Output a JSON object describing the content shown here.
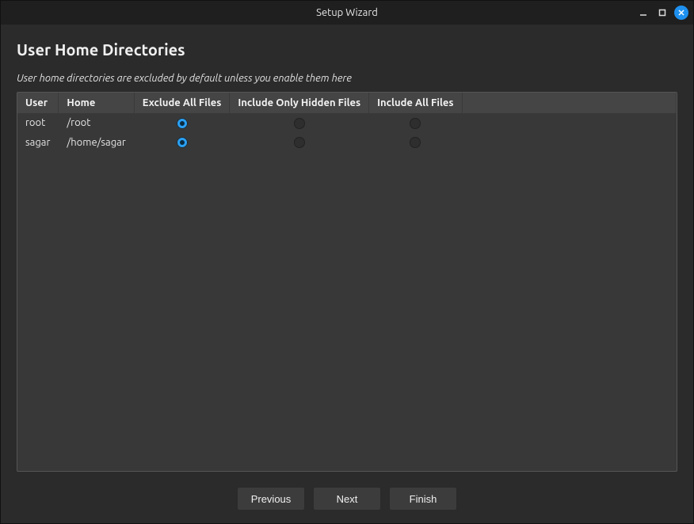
{
  "window": {
    "title": "Setup Wizard"
  },
  "page": {
    "heading": "User Home Directories",
    "subtitle": "User home directories are excluded by default unless you enable them here"
  },
  "table": {
    "headers": {
      "user": "User",
      "home": "Home",
      "exclude_all": "Exclude All Files",
      "include_hidden": "Include Only Hidden Files",
      "include_all": "Include All Files"
    },
    "rows": [
      {
        "user": "root",
        "home": "/root",
        "selected": "exclude_all"
      },
      {
        "user": "sagar",
        "home": "/home/sagar",
        "selected": "exclude_all"
      }
    ]
  },
  "footer": {
    "previous": "Previous",
    "next": "Next",
    "finish": "Finish"
  },
  "colors": {
    "accent": "#2aa0f3",
    "titlebar_close": "#1e90ef"
  }
}
